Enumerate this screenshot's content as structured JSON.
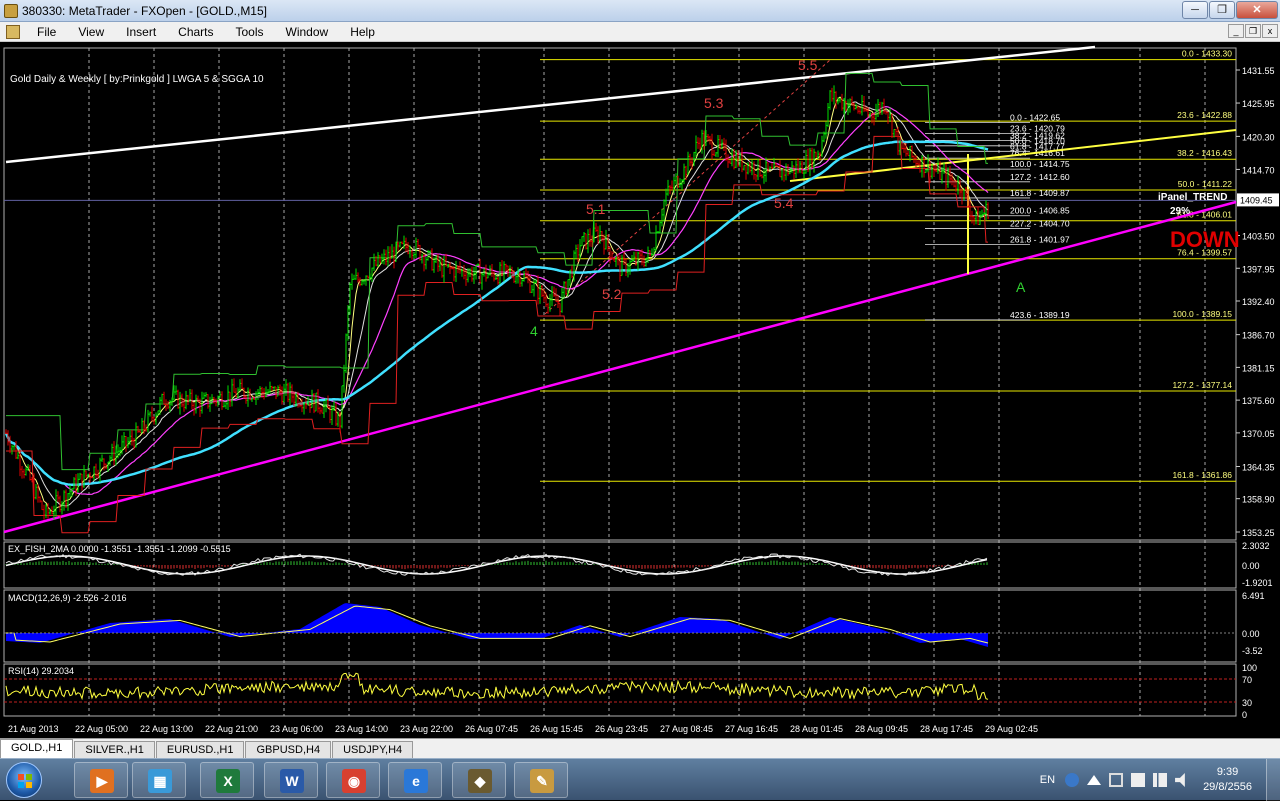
{
  "window": {
    "title": "380330: MetaTrader - FXOpen - [GOLD.,M15]",
    "minimize_glyph": "─",
    "maximize_glyph": "❐",
    "close_glyph": "✕"
  },
  "menu": {
    "items": [
      "File",
      "View",
      "Insert",
      "Charts",
      "Tools",
      "Window",
      "Help"
    ],
    "mdi_min": "_",
    "mdi_restore": "❐",
    "mdi_close": "x"
  },
  "chart": {
    "title": "Gold Daily & Weekly [ by:Prinkgold ]  LWGA 5  &  SGGA 10",
    "current_price": "1409.45",
    "price_axis": [
      "1431.55",
      "1425.95",
      "1420.30",
      "1414.70",
      "1403.50",
      "1397.95",
      "1392.40",
      "1386.70",
      "1381.15",
      "1375.60",
      "1370.05",
      "1364.35",
      "1358.90",
      "1353.25"
    ],
    "time_axis": [
      "21 Aug 2013",
      "22 Aug 05:00",
      "22 Aug 13:00",
      "22 Aug 21:00",
      "23 Aug 06:00",
      "23 Aug 14:00",
      "23 Aug 22:00",
      "26 Aug 07:45",
      "26 Aug 15:45",
      "26 Aug 23:45",
      "27 Aug 08:45",
      "27 Aug 16:45",
      "28 Aug 01:45",
      "28 Aug 09:45",
      "28 Aug 17:45",
      "29 Aug 02:45"
    ],
    "wave_labels": [
      "5.5",
      "5.3",
      "5.1",
      "5.4",
      "5.2",
      "4",
      "A"
    ],
    "fib_right": [
      "0.0 - 1433.30",
      "23.6 - 1422.88",
      "38.2 - 1416.43",
      "50.0 - 1411.22",
      "61.8 - 1406.01",
      "76.4 - 1399.57",
      "100.0 - 1389.15",
      "127.2 - 1377.14",
      "161.8 - 1361.86"
    ],
    "fib_ext": [
      "0.0 - 1422.65",
      "23.6 - 1420.79",
      "38.2 - 1419.62",
      "50.0 - 1418.70",
      "61.8 - 1417.77",
      "76.4 - 1416.61",
      "100.0 - 1414.75",
      "127.2 - 1412.60",
      "161.8 - 1409.87",
      "200.0 - 1406.85",
      "227.2 - 1404.70",
      "261.8 - 1401.97",
      "423.6 - 1389.19"
    ],
    "ipanel": {
      "title": "iPanel_TREND",
      "percent": "29%",
      "direction": "DOWN",
      "trend_color": "#e00000"
    },
    "fisher": {
      "label": "EX_FISH_2MA 0.0000 -1.3551 -1.3551 -1.2099 -0.5515",
      "axis": [
        "2.3032",
        "0.00",
        "-1.9201"
      ]
    },
    "macd": {
      "label": "MACD(12,26,9) -2.526 -2.016",
      "axis": [
        "6.491",
        "0.00",
        "-3.52"
      ]
    },
    "rsi": {
      "label": "RSI(14) 29.2034",
      "axis": [
        "100",
        "70",
        "30",
        "0"
      ]
    }
  },
  "tabs": [
    "GOLD.,H1",
    "SILVER.,H1",
    "EURUSD.,H1",
    "GBPUSD,H4",
    "USDJPY,H4"
  ],
  "taskbar": {
    "apps": [
      {
        "icon": "media-player-icon",
        "glyph": "▶",
        "color": "#e07020"
      },
      {
        "icon": "gallery-icon",
        "glyph": "▦",
        "color": "#3a9ad8"
      },
      {
        "icon": "excel-icon",
        "glyph": "X",
        "color": "#1f7a3c"
      },
      {
        "icon": "word-icon",
        "glyph": "W",
        "color": "#2a5aa8"
      },
      {
        "icon": "chrome-icon",
        "glyph": "◉",
        "color": "#d84030"
      },
      {
        "icon": "internet-explorer-icon",
        "glyph": "e",
        "color": "#2a78d8"
      },
      {
        "icon": "metatrader-icon",
        "glyph": "◆",
        "color": "#6a5a30"
      },
      {
        "icon": "paint-icon",
        "glyph": "✎",
        "color": "#c89a40"
      }
    ],
    "lang": "EN",
    "time": "9:39",
    "date": "29/8/2556"
  },
  "colors": {
    "candle_up": "#00e000",
    "candle_down": "#e00000",
    "trendline": "#ff00ff",
    "ma_fast": "#ffff80",
    "ma_slow": "#ff40ff",
    "ma_long": "#40e0ff",
    "fib": "#e8e800",
    "grid": "#808080"
  }
}
